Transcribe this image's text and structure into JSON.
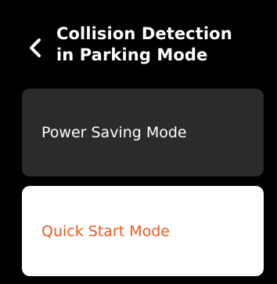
{
  "header": {
    "back_icon": "chevron-left-icon",
    "title_line1": "Collision Detection",
    "title_line2": "in Parking Mode"
  },
  "options": [
    {
      "label": "Power Saving Mode",
      "selected": false
    },
    {
      "label": "Quick Start Mode",
      "selected": true
    }
  ],
  "colors": {
    "background": "#000000",
    "option_bg": "#2b2b2b",
    "selected_bg": "#ffffff",
    "selected_text": "#ea5a22",
    "text": "#ffffff"
  }
}
